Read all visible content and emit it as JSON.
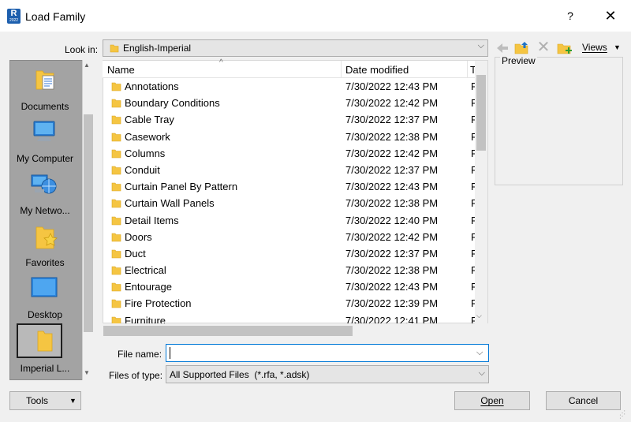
{
  "window": {
    "title": "Load Family",
    "help_label": "?",
    "close_label": "✕",
    "icon_letter": "R",
    "icon_sub": "2022"
  },
  "toolbar": {
    "look_in_label": "Look in:",
    "look_in_value": "English-Imperial",
    "views_label": "Views"
  },
  "places": [
    {
      "label": "Documents",
      "icon": "documents-icon"
    },
    {
      "label": "My Computer",
      "icon": "computer-icon"
    },
    {
      "label": "My Netwo...",
      "icon": "network-icon"
    },
    {
      "label": "Favorites",
      "icon": "favorites-icon"
    },
    {
      "label": "Desktop",
      "icon": "desktop-icon"
    },
    {
      "label": "Imperial L...",
      "icon": "folder-icon"
    }
  ],
  "file_list": {
    "columns": {
      "name": "Name",
      "date": "Date modified",
      "type": "T"
    },
    "rows": [
      {
        "name": "Annotations",
        "date": "7/30/2022 12:43 PM",
        "type": "F"
      },
      {
        "name": "Boundary Conditions",
        "date": "7/30/2022 12:42 PM",
        "type": "F"
      },
      {
        "name": "Cable Tray",
        "date": "7/30/2022 12:37 PM",
        "type": "F"
      },
      {
        "name": "Casework",
        "date": "7/30/2022 12:38 PM",
        "type": "F"
      },
      {
        "name": "Columns",
        "date": "7/30/2022 12:42 PM",
        "type": "F"
      },
      {
        "name": "Conduit",
        "date": "7/30/2022 12:37 PM",
        "type": "F"
      },
      {
        "name": "Curtain Panel By Pattern",
        "date": "7/30/2022 12:43 PM",
        "type": "F"
      },
      {
        "name": "Curtain Wall Panels",
        "date": "7/30/2022 12:38 PM",
        "type": "F"
      },
      {
        "name": "Detail Items",
        "date": "7/30/2022 12:40 PM",
        "type": "F"
      },
      {
        "name": "Doors",
        "date": "7/30/2022 12:42 PM",
        "type": "F"
      },
      {
        "name": "Duct",
        "date": "7/30/2022 12:37 PM",
        "type": "F"
      },
      {
        "name": "Electrical",
        "date": "7/30/2022 12:38 PM",
        "type": "F"
      },
      {
        "name": "Entourage",
        "date": "7/30/2022 12:43 PM",
        "type": "F"
      },
      {
        "name": "Fire Protection",
        "date": "7/30/2022 12:39 PM",
        "type": "F"
      },
      {
        "name": "Furniture",
        "date": "7/30/2022 12:41 PM",
        "type": "F"
      }
    ]
  },
  "preview": {
    "label": "Preview"
  },
  "file_name": {
    "label": "File name:",
    "value": ""
  },
  "files_of_type": {
    "label": "Files of type:",
    "value": "All Supported Files  (*.rfa, *.adsk)"
  },
  "buttons": {
    "tools": "Tools",
    "open": "Open",
    "cancel": "Cancel"
  },
  "colors": {
    "folder": "#f5c542",
    "accent": "#0078d7",
    "places_bg": "#a3a3a3"
  }
}
